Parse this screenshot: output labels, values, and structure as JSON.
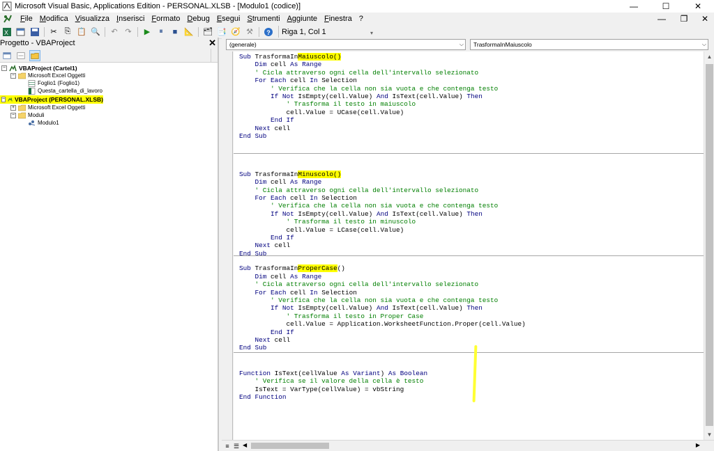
{
  "window": {
    "title": "Microsoft Visual Basic, Applications Edition - PERSONAL.XLSB - [Modulo1 (codice)]",
    "controls": [
      "—",
      "☐",
      "✕"
    ]
  },
  "menu": {
    "items": [
      "File",
      "Modifica",
      "Visualizza",
      "Inserisci",
      "Formato",
      "Debug",
      "Esegui",
      "Strumenti",
      "Aggiunte",
      "Finestra",
      "?"
    ],
    "doc_controls": [
      "—",
      "❐",
      "✕"
    ]
  },
  "toolbar": {
    "position": "Riga 1, Col 1"
  },
  "project": {
    "title": "Progetto - VBAProject",
    "close": "✕",
    "tree": [
      {
        "label": "VBAProject (Cartel1)",
        "bold": true,
        "expander": "−",
        "highlight": false
      },
      {
        "label": "Microsoft Excel Oggetti",
        "bold": false,
        "expander": "−",
        "highlight": false
      },
      {
        "label": "Foglio1 (Foglio1)",
        "bold": false,
        "expander": "",
        "highlight": false
      },
      {
        "label": "Questa_cartella_di_lavoro",
        "bold": false,
        "expander": "",
        "highlight": false
      },
      {
        "label": "VBAProject (PERSONAL.XLSB)",
        "bold": true,
        "expander": "−",
        "highlight": true
      },
      {
        "label": "Microsoft Excel Oggetti",
        "bold": false,
        "expander": "+",
        "highlight": false
      },
      {
        "label": "Moduli",
        "bold": false,
        "expander": "−",
        "highlight": false
      },
      {
        "label": "Modulo1",
        "bold": false,
        "expander": "",
        "highlight": false
      }
    ]
  },
  "code": {
    "object_combo": "(generale)",
    "procedure_combo": "TrasformaInMaiuscolo",
    "procedures": [
      {
        "lines": [
          [
            {
              "t": "Sub",
              "c": "kw"
            },
            {
              "t": " TrasformaIn",
              "c": ""
            },
            {
              "t": "Maiuscolo()",
              "c": "mark"
            }
          ],
          [
            {
              "t": "    Dim cell As Range",
              "c": "kw2"
            }
          ],
          [
            {
              "t": "    ' Cicla attraverso ogni cella dell'intervallo selezionato",
              "c": "cm"
            }
          ],
          [
            {
              "t": "    For Each cell In Selection",
              "c": "kw2"
            }
          ],
          [
            {
              "t": "        ' Verifica che la cella non sia vuota e che contenga testo",
              "c": "cm"
            }
          ],
          [
            {
              "t": "        If Not IsEmpty(cell.Value) And IsText(cell.Value) Then",
              "c": "kw2"
            }
          ],
          [
            {
              "t": "            ' Trasforma il testo in maiuscolo",
              "c": "cm"
            }
          ],
          [
            {
              "t": "            cell.Value = UCase(cell.Value)",
              "c": ""
            }
          ],
          [
            {
              "t": "        End If",
              "c": "kw2"
            }
          ],
          [
            {
              "t": "    Next cell",
              "c": "kw2"
            }
          ],
          [
            {
              "t": "End Sub",
              "c": "kw2"
            }
          ]
        ]
      },
      {
        "lines": [
          [
            {
              "t": "",
              "c": ""
            }
          ],
          [
            {
              "t": "",
              "c": ""
            }
          ],
          [
            {
              "t": "Sub",
              "c": "kw"
            },
            {
              "t": " TrasformaIn",
              "c": ""
            },
            {
              "t": "Minuscolo()",
              "c": "mark"
            }
          ],
          [
            {
              "t": "    Dim cell As Range",
              "c": "kw2"
            }
          ],
          [
            {
              "t": "    ' Cicla attraverso ogni cella dell'intervallo selezionato",
              "c": "cm"
            }
          ],
          [
            {
              "t": "    For Each cell In Selection",
              "c": "kw2"
            }
          ],
          [
            {
              "t": "        ' Verifica che la cella non sia vuota e che contenga testo",
              "c": "cm"
            }
          ],
          [
            {
              "t": "        If Not IsEmpty(cell.Value) And IsText(cell.Value) Then",
              "c": "kw2"
            }
          ],
          [
            {
              "t": "            ' Trasforma il testo in minuscolo",
              "c": "cm"
            }
          ],
          [
            {
              "t": "            cell.Value = LCase(cell.Value)",
              "c": ""
            }
          ],
          [
            {
              "t": "        End If",
              "c": "kw2"
            }
          ],
          [
            {
              "t": "    Next cell",
              "c": "kw2"
            }
          ],
          [
            {
              "t": "End Sub",
              "c": "kw2"
            }
          ]
        ]
      },
      {
        "lines": [
          [
            {
              "t": "",
              "c": ""
            }
          ],
          [
            {
              "t": "Sub",
              "c": "kw"
            },
            {
              "t": " TrasformaIn",
              "c": ""
            },
            {
              "t": "ProperCase",
              "c": "mark"
            },
            {
              "t": "()",
              "c": ""
            }
          ],
          [
            {
              "t": "    Dim cell As Range",
              "c": "kw2"
            }
          ],
          [
            {
              "t": "    ' Cicla attraverso ogni cella dell'intervallo selezionato",
              "c": "cm"
            }
          ],
          [
            {
              "t": "    For Each cell In Selection",
              "c": "kw2"
            }
          ],
          [
            {
              "t": "        ' Verifica che la cella non sia vuota e che contenga testo",
              "c": "cm"
            }
          ],
          [
            {
              "t": "        If Not IsEmpty(cell.Value) And IsText(cell.Value) Then",
              "c": "kw2"
            }
          ],
          [
            {
              "t": "            ' Trasforma il testo in Proper Case",
              "c": "cm"
            }
          ],
          [
            {
              "t": "            cell.Value = Application.WorksheetFunction.Proper(cell.Value)",
              "c": ""
            }
          ],
          [
            {
              "t": "        End If",
              "c": "kw2"
            }
          ],
          [
            {
              "t": "    Next cell",
              "c": "kw2"
            }
          ],
          [
            {
              "t": "End Sub",
              "c": "kw2"
            }
          ]
        ]
      },
      {
        "lines": [
          [
            {
              "t": "",
              "c": ""
            }
          ],
          [
            {
              "t": "",
              "c": ""
            }
          ],
          [
            {
              "t": "Function IsText(cellValue As Variant) As Boolean",
              "c": "kw2"
            }
          ],
          [
            {
              "t": "    ' Verifica se il valore della cella è testo",
              "c": "cm"
            }
          ],
          [
            {
              "t": "    IsText = VarType(cellValue) = vbString",
              "c": ""
            }
          ],
          [
            {
              "t": "End Function",
              "c": "kw2"
            }
          ]
        ]
      }
    ]
  },
  "colors": {
    "keyword": "#00007f",
    "comment": "#007f00",
    "highlight": "#ffff00"
  }
}
